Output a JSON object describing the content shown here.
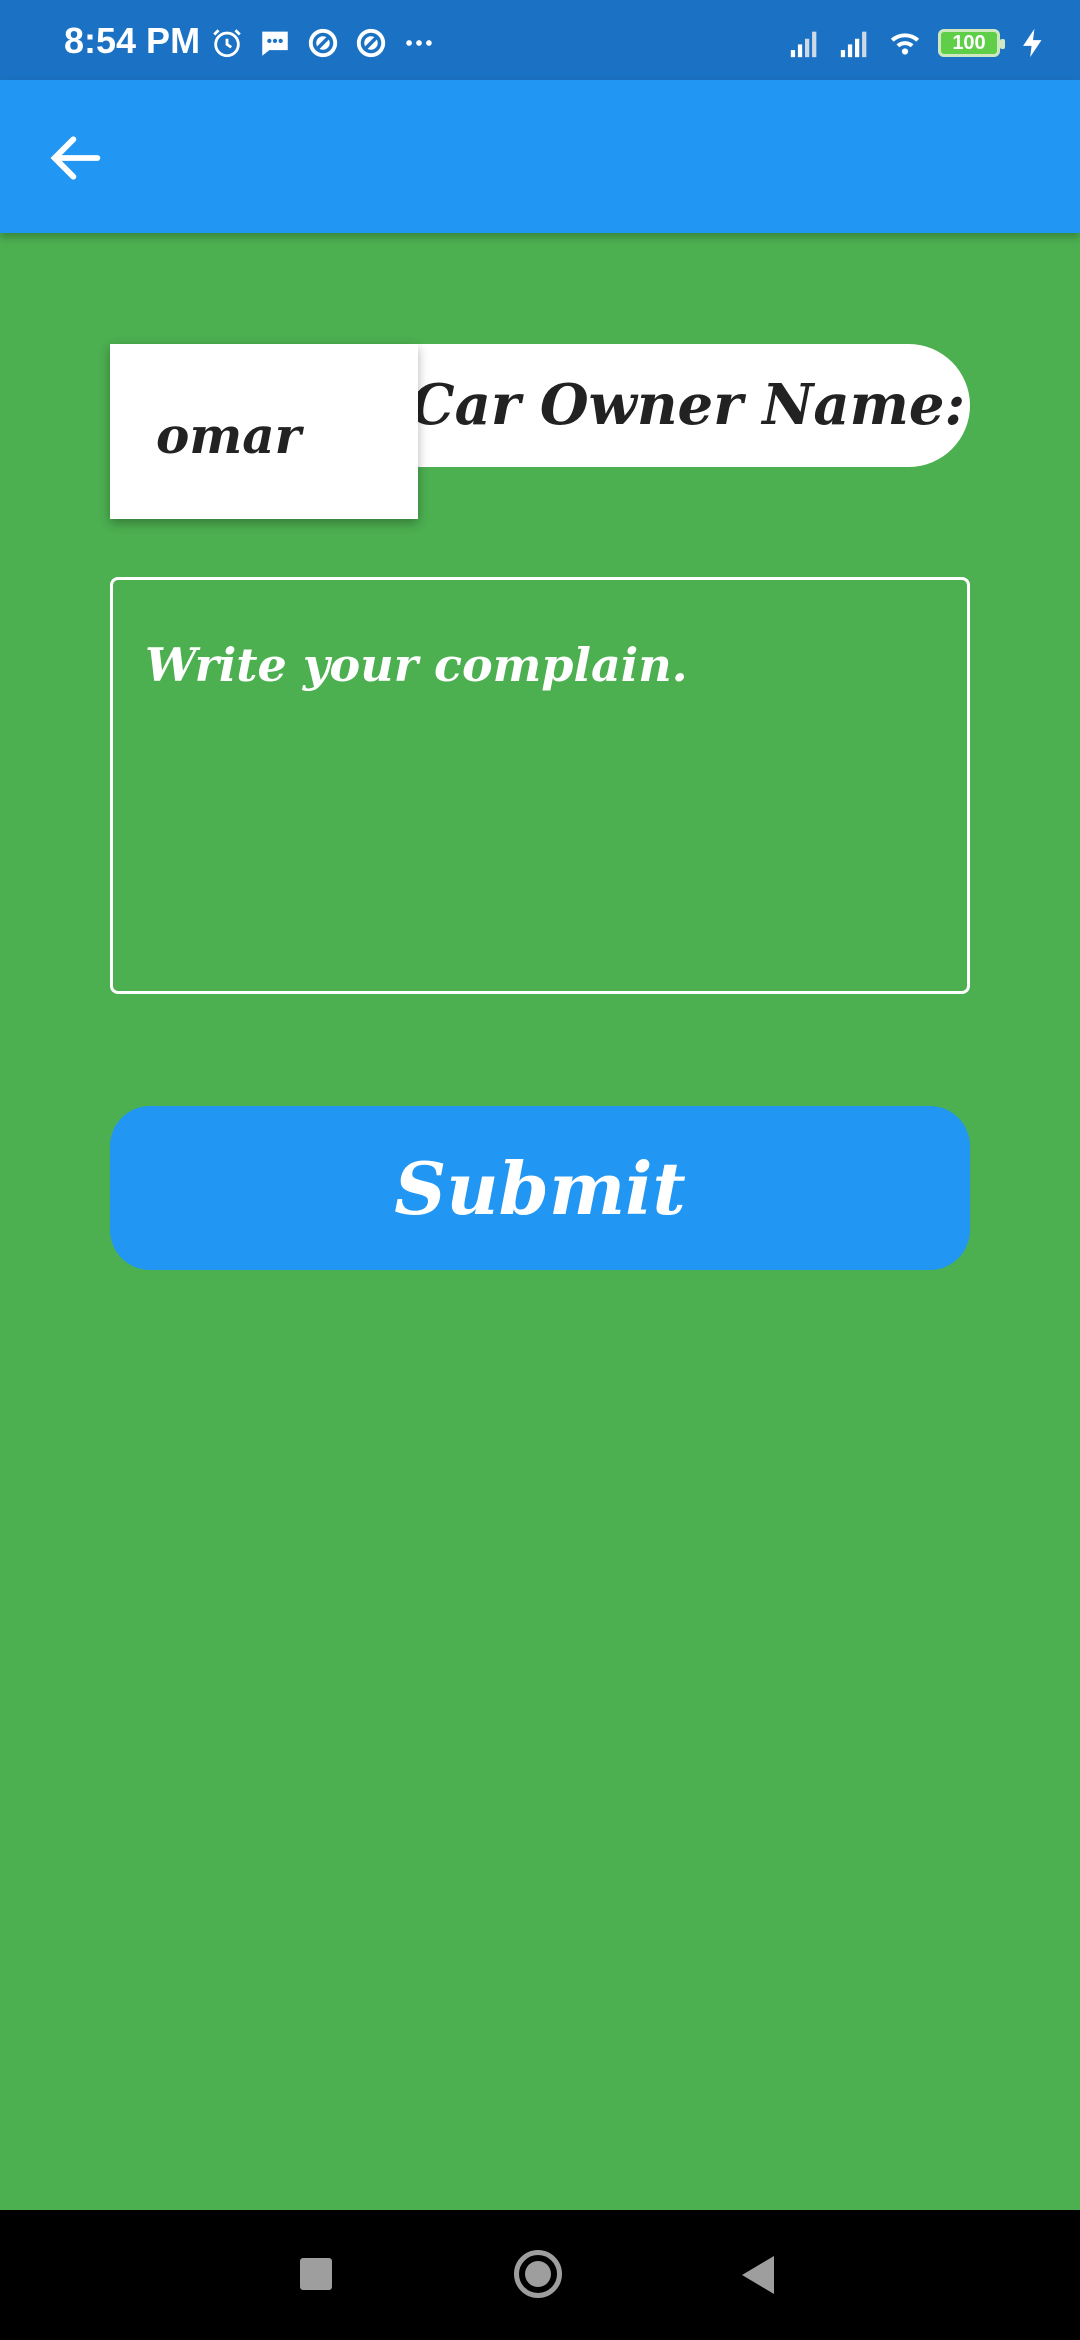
{
  "status_bar": {
    "time": "8:54 PM",
    "battery": "100",
    "icons_left": [
      "alarm-icon",
      "message-icon",
      "at-icon",
      "at-icon",
      "more-icon"
    ],
    "icons_right": [
      "signal-icon",
      "signal-icon",
      "wifi-icon",
      "battery-icon",
      "charging-icon"
    ]
  },
  "app_bar": {
    "back_icon": "arrow-left-icon"
  },
  "form": {
    "owner_label": "Car Owner Name:",
    "owner_selected": "omar",
    "complaint_placeholder": "Write your complain.",
    "submit_label": "Submit"
  },
  "colors": {
    "background": "#4caf50",
    "app_bar": "#2196f3",
    "status_bar": "#1b72c4",
    "button": "#2196f3"
  },
  "nav_bar": {
    "items": [
      "recents-icon",
      "home-icon",
      "back-icon"
    ]
  }
}
